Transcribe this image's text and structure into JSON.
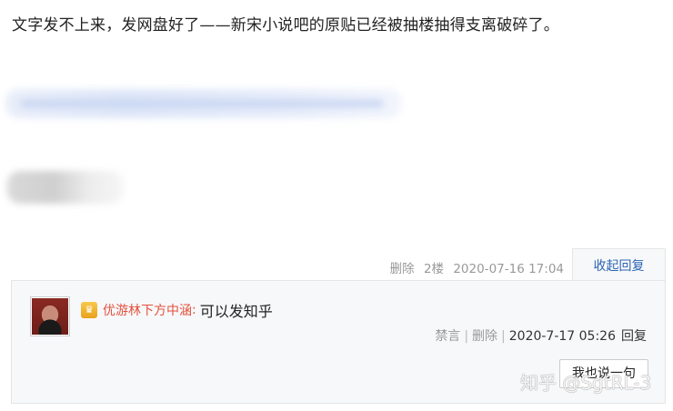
{
  "post": {
    "text": "文字发不上来，发网盘好了——新宋小说吧的原贴已经被抽楼抽得支离破碎了。"
  },
  "floor": {
    "delete_label": "删除",
    "floor_label": "2楼",
    "timestamp": "2020-07-16 17:04",
    "collapse_label": "收起回复"
  },
  "reply": {
    "user_badge_icon": "crown-badge-icon",
    "username": "优游林下方中涵",
    "colon": ":",
    "text": "可以发知乎",
    "ban_label": "禁言",
    "delete_label": "删除",
    "timestamp": "2020-7-17 05:26",
    "reply_label": "回复",
    "say_button_label": "我也说一句"
  },
  "watermark": {
    "text": "知乎 @SgtRL-3"
  },
  "colors": {
    "username": "#e3523d",
    "link_blue": "#2d64b3",
    "panel_bg": "#f7f8fa"
  }
}
